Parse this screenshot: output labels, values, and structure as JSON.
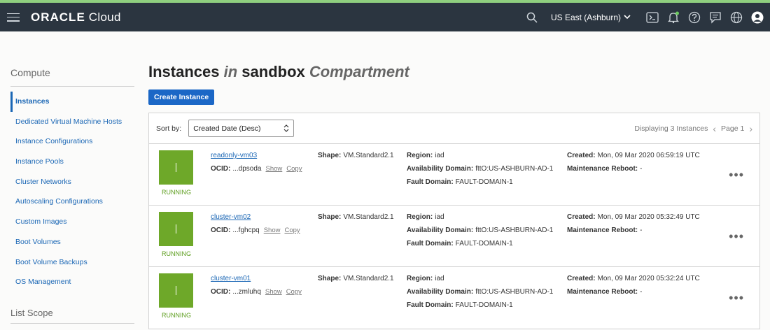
{
  "header": {
    "brand_bold": "ORACLE",
    "brand_light": " Cloud",
    "region": "US East (Ashburn)",
    "icons": [
      "search-icon",
      "terminal-icon",
      "bell-icon",
      "help-icon",
      "chat-icon",
      "globe-icon",
      "user-icon"
    ]
  },
  "sidebar": {
    "heading": "Compute",
    "items": [
      {
        "label": "Instances",
        "active": true
      },
      {
        "label": "Dedicated Virtual Machine Hosts"
      },
      {
        "label": "Instance Configurations"
      },
      {
        "label": "Instance Pools"
      },
      {
        "label": "Cluster Networks"
      },
      {
        "label": "Autoscaling Configurations"
      },
      {
        "label": "Custom Images"
      },
      {
        "label": "Boot Volumes"
      },
      {
        "label": "Boot Volume Backups"
      },
      {
        "label": "OS Management"
      }
    ],
    "scope_heading": "List Scope"
  },
  "main": {
    "title_a": "Instances ",
    "title_in": "in",
    "title_b": " sandbox ",
    "title_c": "Compartment",
    "create_button": "Create Instance",
    "sort_label": "Sort by:",
    "sort_value": "Created Date (Desc)",
    "displaying": "Displaying 3 Instances",
    "page": "Page 1"
  },
  "labels": {
    "ocid": "OCID:",
    "show": "Show",
    "copy": "Copy",
    "shape": "Shape:",
    "region": "Region:",
    "ad": "Availability Domain:",
    "fd": "Fault Domain:",
    "created": "Created:",
    "maint": "Maintenance Reboot:"
  },
  "instances": [
    {
      "name": "readonly-vm03",
      "status": "RUNNING",
      "ocid": "...dpsoda",
      "shape": "VM.Standard2.1",
      "region": "iad",
      "ad": "fttO:US-ASHBURN-AD-1",
      "fd": "FAULT-DOMAIN-1",
      "created": "Mon, 09 Mar 2020 06:59:19 UTC",
      "maint": "-"
    },
    {
      "name": "cluster-vm02",
      "status": "RUNNING",
      "ocid": "...fghcpq",
      "shape": "VM.Standard2.1",
      "region": "iad",
      "ad": "fttO:US-ASHBURN-AD-1",
      "fd": "FAULT-DOMAIN-1",
      "created": "Mon, 09 Mar 2020 05:32:49 UTC",
      "maint": "-"
    },
    {
      "name": "cluster-vm01",
      "status": "RUNNING",
      "ocid": "...zmluhq",
      "shape": "VM.Standard2.1",
      "region": "iad",
      "ad": "fttO:US-ASHBURN-AD-1",
      "fd": "FAULT-DOMAIN-1",
      "created": "Mon, 09 Mar 2020 05:32:24 UTC",
      "maint": "-"
    }
  ],
  "colors": {
    "topbar": "#2b3540",
    "accent": "#1b67c6",
    "running": "#6ea829"
  }
}
